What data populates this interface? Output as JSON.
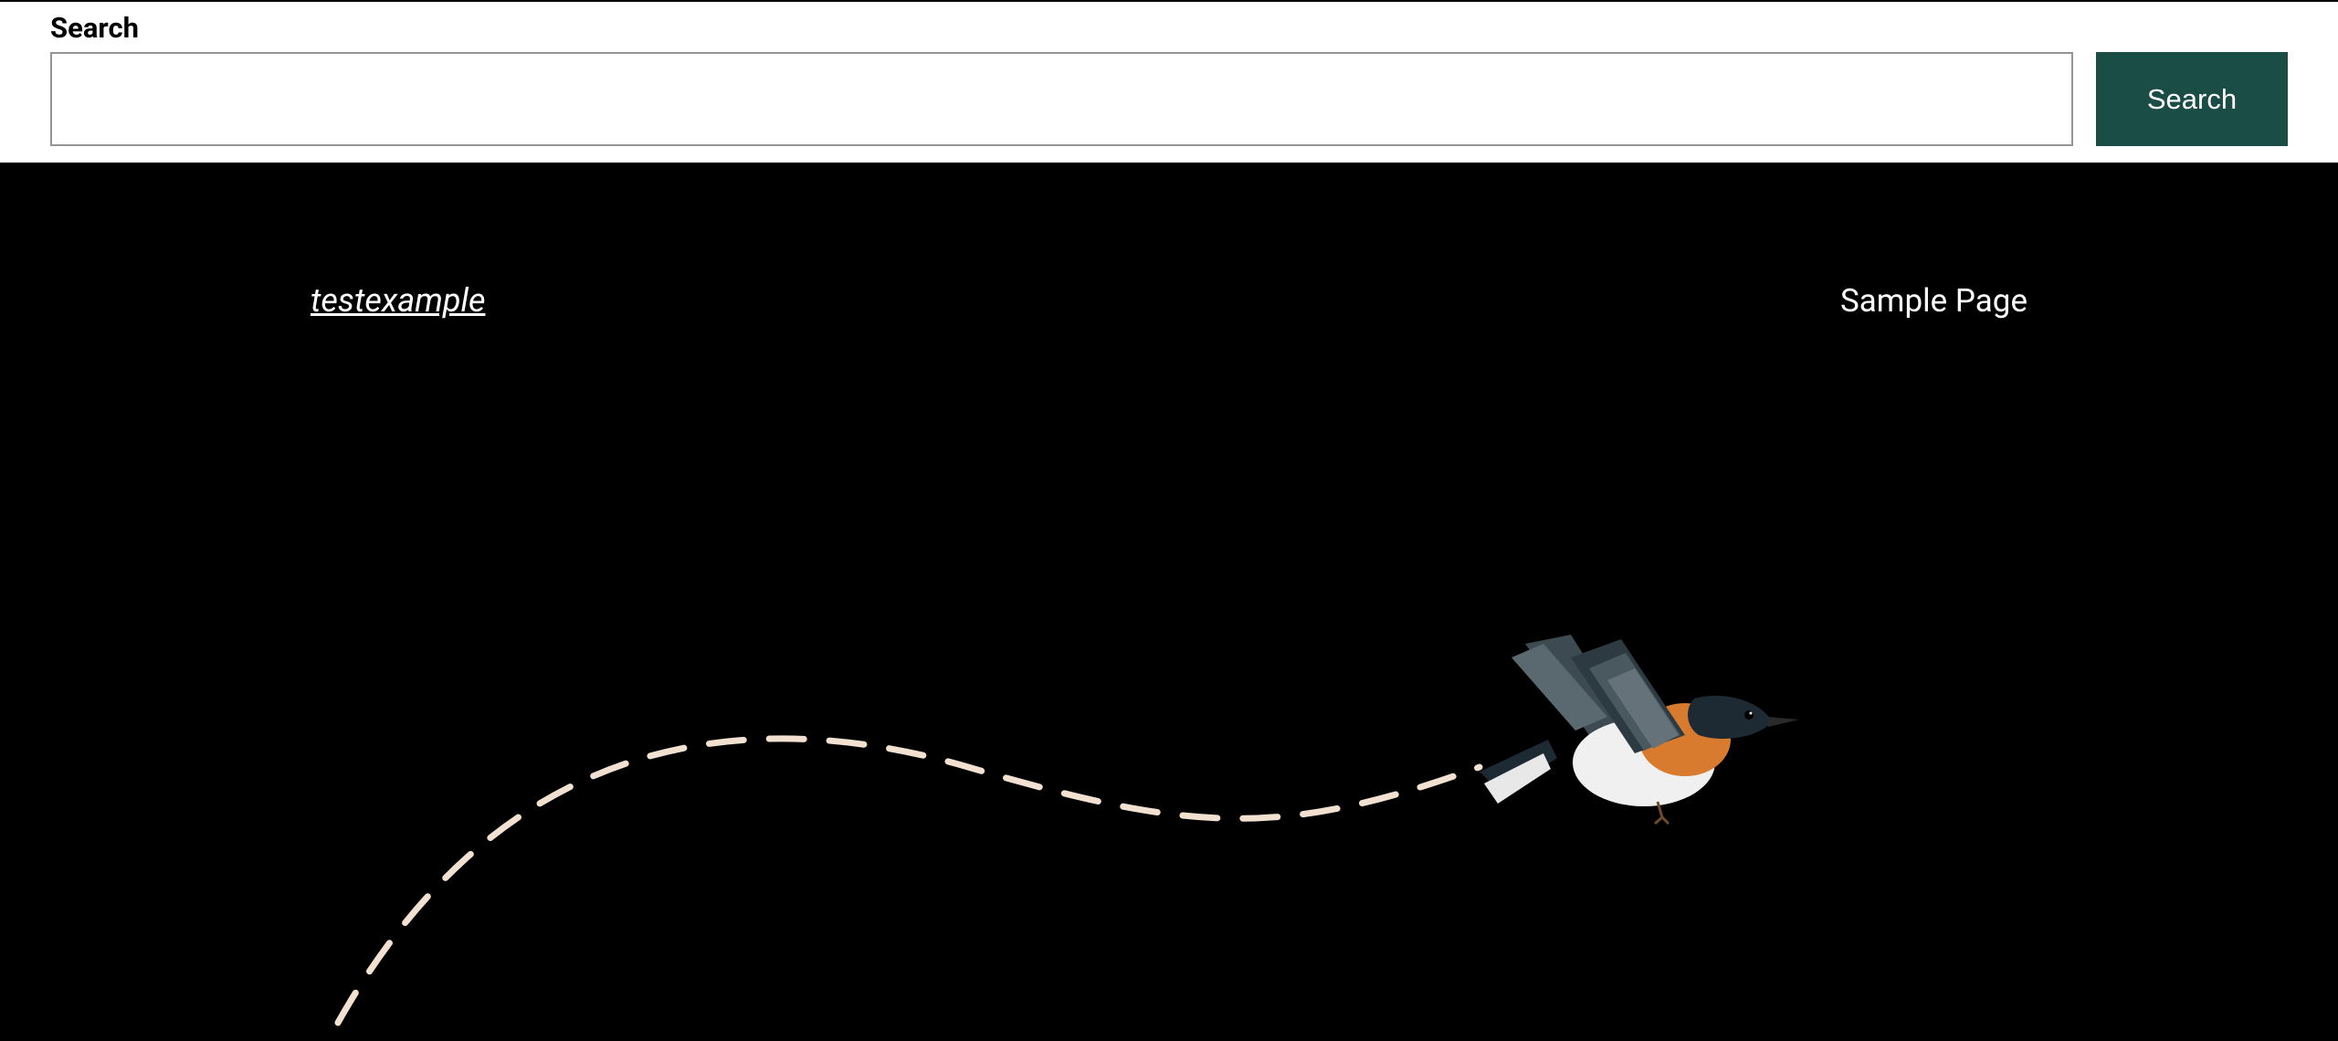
{
  "search": {
    "label": "Search",
    "button_label": "Search",
    "value": ""
  },
  "header": {
    "site_title": "testexample",
    "nav": {
      "items": [
        {
          "label": "Sample Page"
        }
      ]
    }
  },
  "colors": {
    "search_button_bg": "#1b4d47",
    "page_bg": "#000000",
    "trail": "#f2e0d0"
  }
}
